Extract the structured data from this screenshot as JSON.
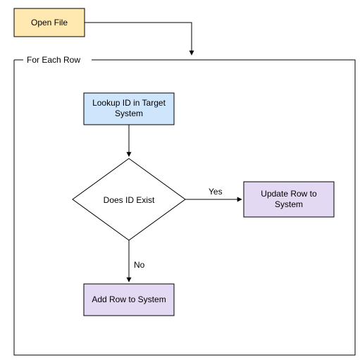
{
  "nodes": {
    "open_file": "Open File",
    "loop_label": "For Each Row",
    "lookup": {
      "line1": "Lookup ID in Target",
      "line2": "System"
    },
    "decision": "Does ID Exist",
    "yes": "Yes",
    "no": "No",
    "update": {
      "line1": "Update Row to",
      "line2": "System"
    },
    "add": "Add Row to System"
  }
}
